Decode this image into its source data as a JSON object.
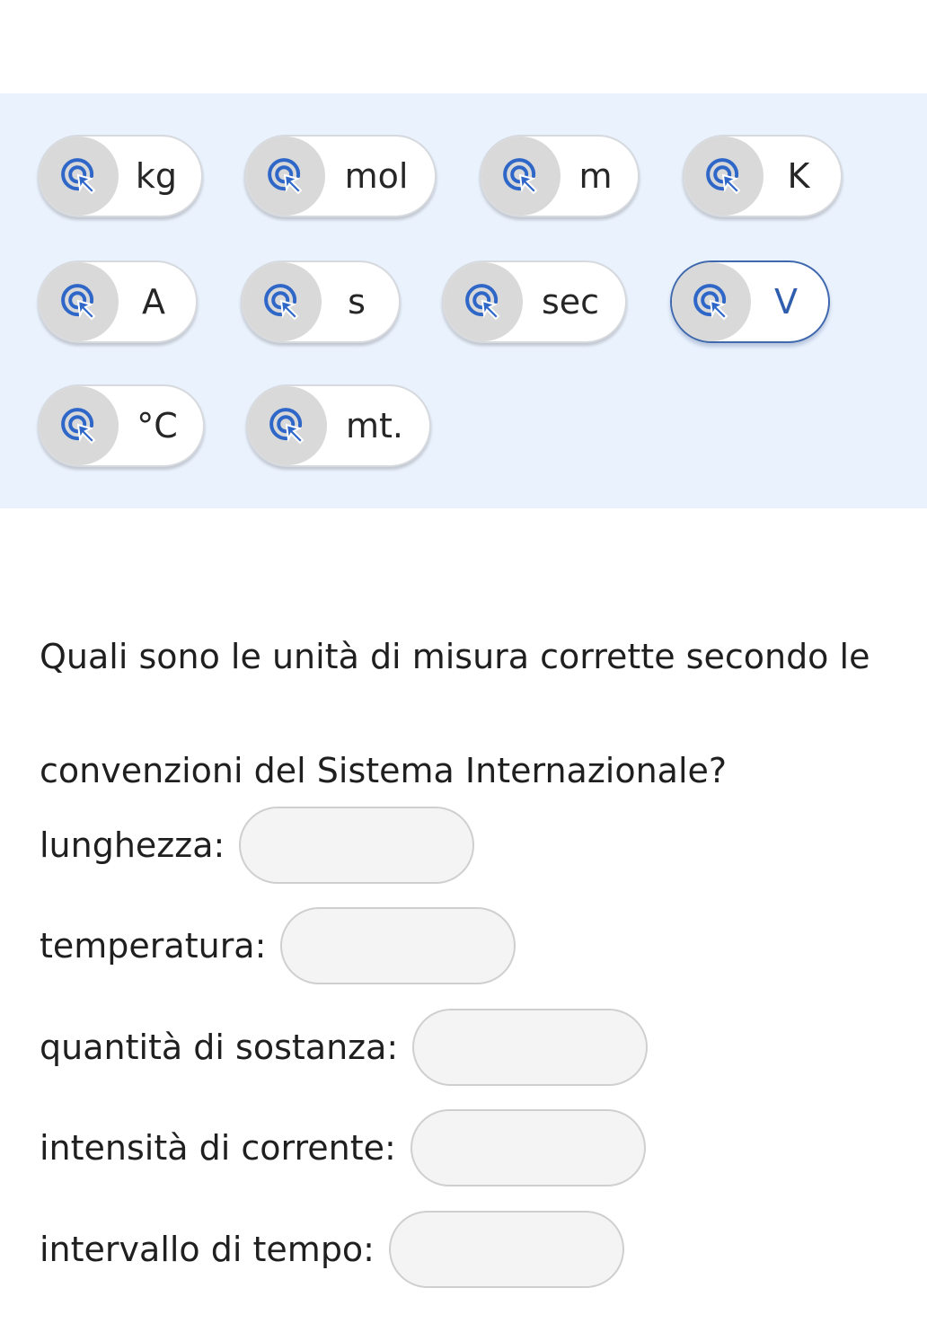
{
  "chips": [
    {
      "label": "kg"
    },
    {
      "label": "mol"
    },
    {
      "label": "m"
    },
    {
      "label": "K"
    },
    {
      "label": "A"
    },
    {
      "label": "s"
    },
    {
      "label": "sec"
    },
    {
      "label": "V"
    },
    {
      "label": "°C"
    },
    {
      "label": "mt."
    }
  ],
  "chip_icon": "drag-cursor-icon",
  "selected_chip": "V",
  "question": {
    "text": "Quali sono le unità di misura corrette secondo le convenzioni del Sistema Internazionale?"
  },
  "rows": [
    {
      "label": "lunghezza:"
    },
    {
      "label": "temperatura:"
    },
    {
      "label": "quantità di sostanza:"
    },
    {
      "label": "intensità di corrente:"
    },
    {
      "label": "intervallo di tempo:"
    }
  ],
  "colors": {
    "tray_background": "#eaf2fd",
    "selected_border": "#3f68ad",
    "icon_blue": "#2f67c8"
  }
}
